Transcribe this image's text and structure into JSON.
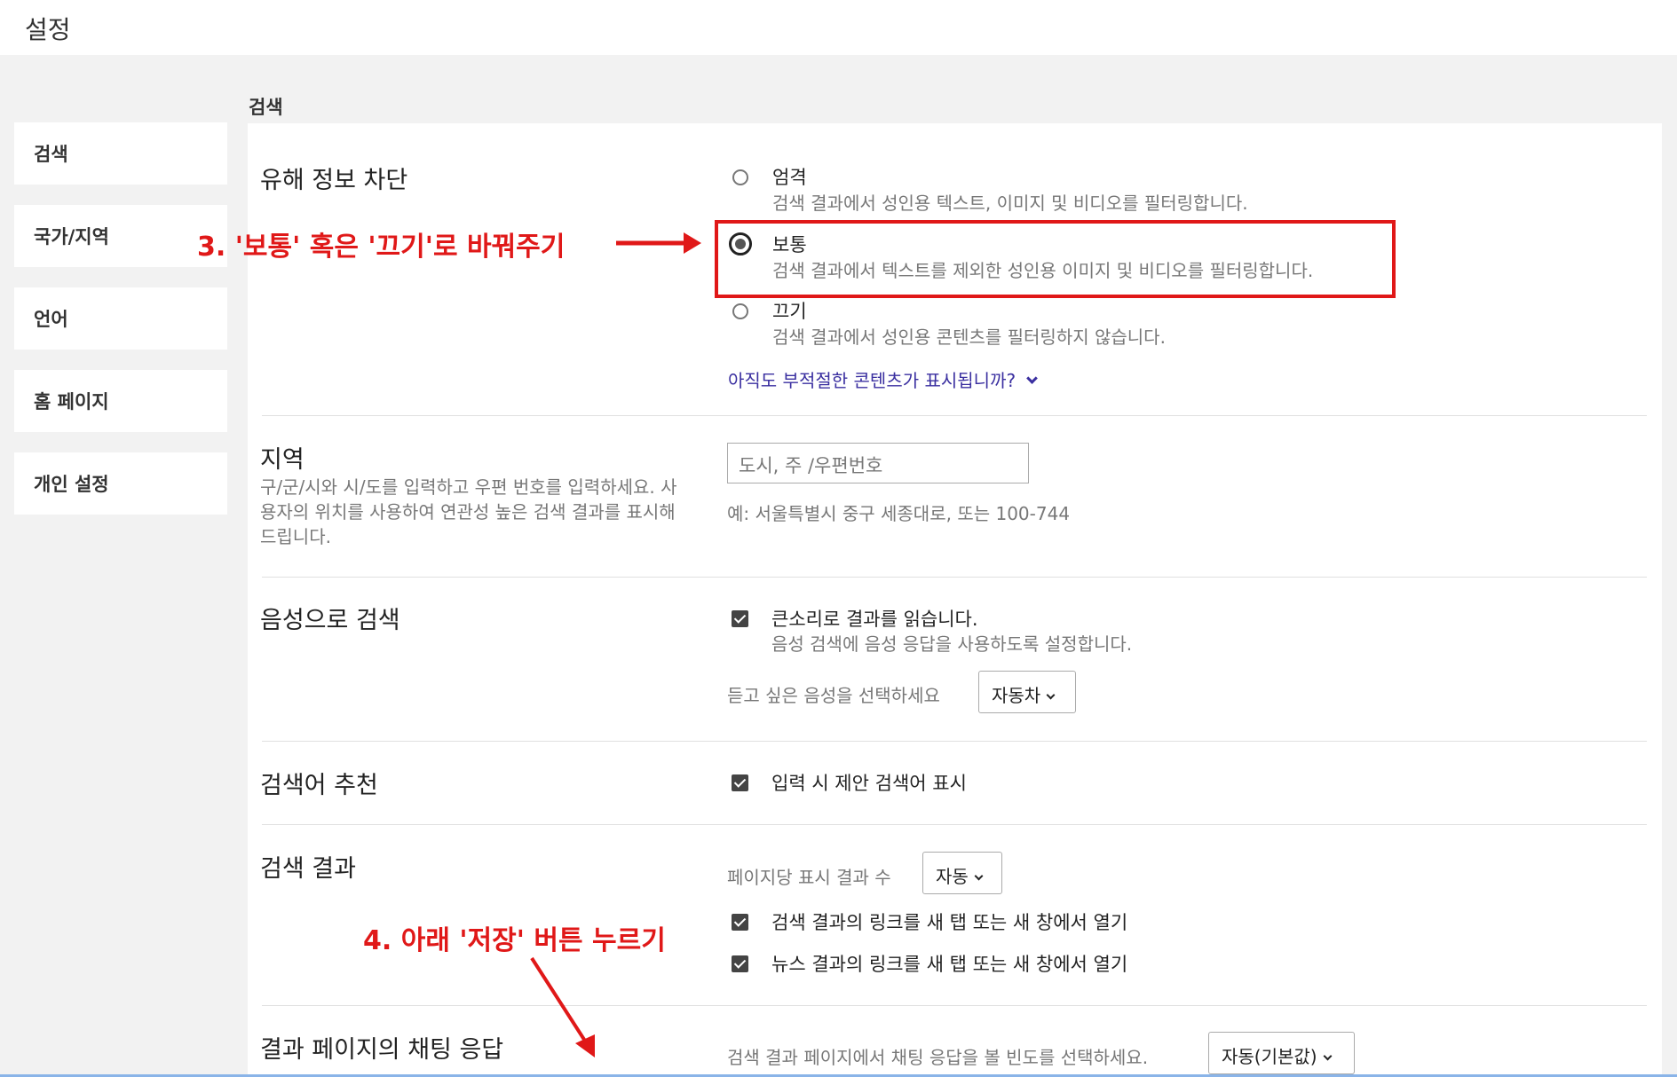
{
  "page": {
    "title": "설정"
  },
  "sidebar": {
    "items": [
      {
        "label": "검색"
      },
      {
        "label": "국가/지역"
      },
      {
        "label": "언어"
      },
      {
        "label": "홈 페이지"
      },
      {
        "label": "개인 설정"
      }
    ]
  },
  "section": {
    "title": "검색"
  },
  "safe_search": {
    "label": "유해 정보 차단",
    "selected": "보통",
    "options": [
      {
        "title": "엄격",
        "desc": "검색 결과에서 성인용 텍스트, 이미지 및 비디오를 필터링합니다."
      },
      {
        "title": "보통",
        "desc": "검색 결과에서 텍스트를 제외한 성인용 이미지 및 비디오를 필터링합니다."
      },
      {
        "title": "끄기",
        "desc": "검색 결과에서 성인용 콘텐츠를 필터링하지 않습니다."
      }
    ],
    "link": "아직도 부적절한 콘텐츠가 표시됩니까?"
  },
  "region": {
    "label": "지역",
    "desc": "구/군/시와 시/도를 입력하고 우편 번호를 입력하세요. 사용자의 위치를 사용하여 연관성 높은 검색 결과를 표시해드립니다.",
    "placeholder": "도시, 주 /우편번호",
    "hint": "예: 서울특별시 중구 세종대로, 또는 100-744"
  },
  "voice": {
    "label": "음성으로 검색",
    "checkbox_title": "큰소리로 결과를 읽습니다.",
    "checkbox_desc": "음성 검색에 음성 응답을 사용하도록 설정합니다.",
    "checked": true,
    "select_label": "듣고 싶은 음성을 선택하세요",
    "select_value": "자동차"
  },
  "suggest": {
    "label": "검색어 추천",
    "checkbox_title": "입력 시 제안 검색어 표시",
    "checked": true
  },
  "results": {
    "label": "검색 결과",
    "per_page_label": "페이지당 표시 결과 수",
    "per_page_value": "자동",
    "check1": "검색 결과의 링크를 새 탭 또는 새 창에서 열기",
    "check2": "뉴스 결과의 링크를 새 탭 또는 새 창에서 열기",
    "check1_checked": true,
    "check2_checked": true
  },
  "chat": {
    "label": "결과 페이지의 채팅 응답",
    "select_label": "검색 결과 페이지에서 채팅 응답을 볼 빈도를 선택하세요.",
    "select_value": "자동(기본값)"
  },
  "annotations": {
    "step3": "3. '보통' 혹은 '끄기'로 바꿔주기",
    "step4": "4. 아래 '저장' 버튼 누르기",
    "color": "#e01818"
  }
}
